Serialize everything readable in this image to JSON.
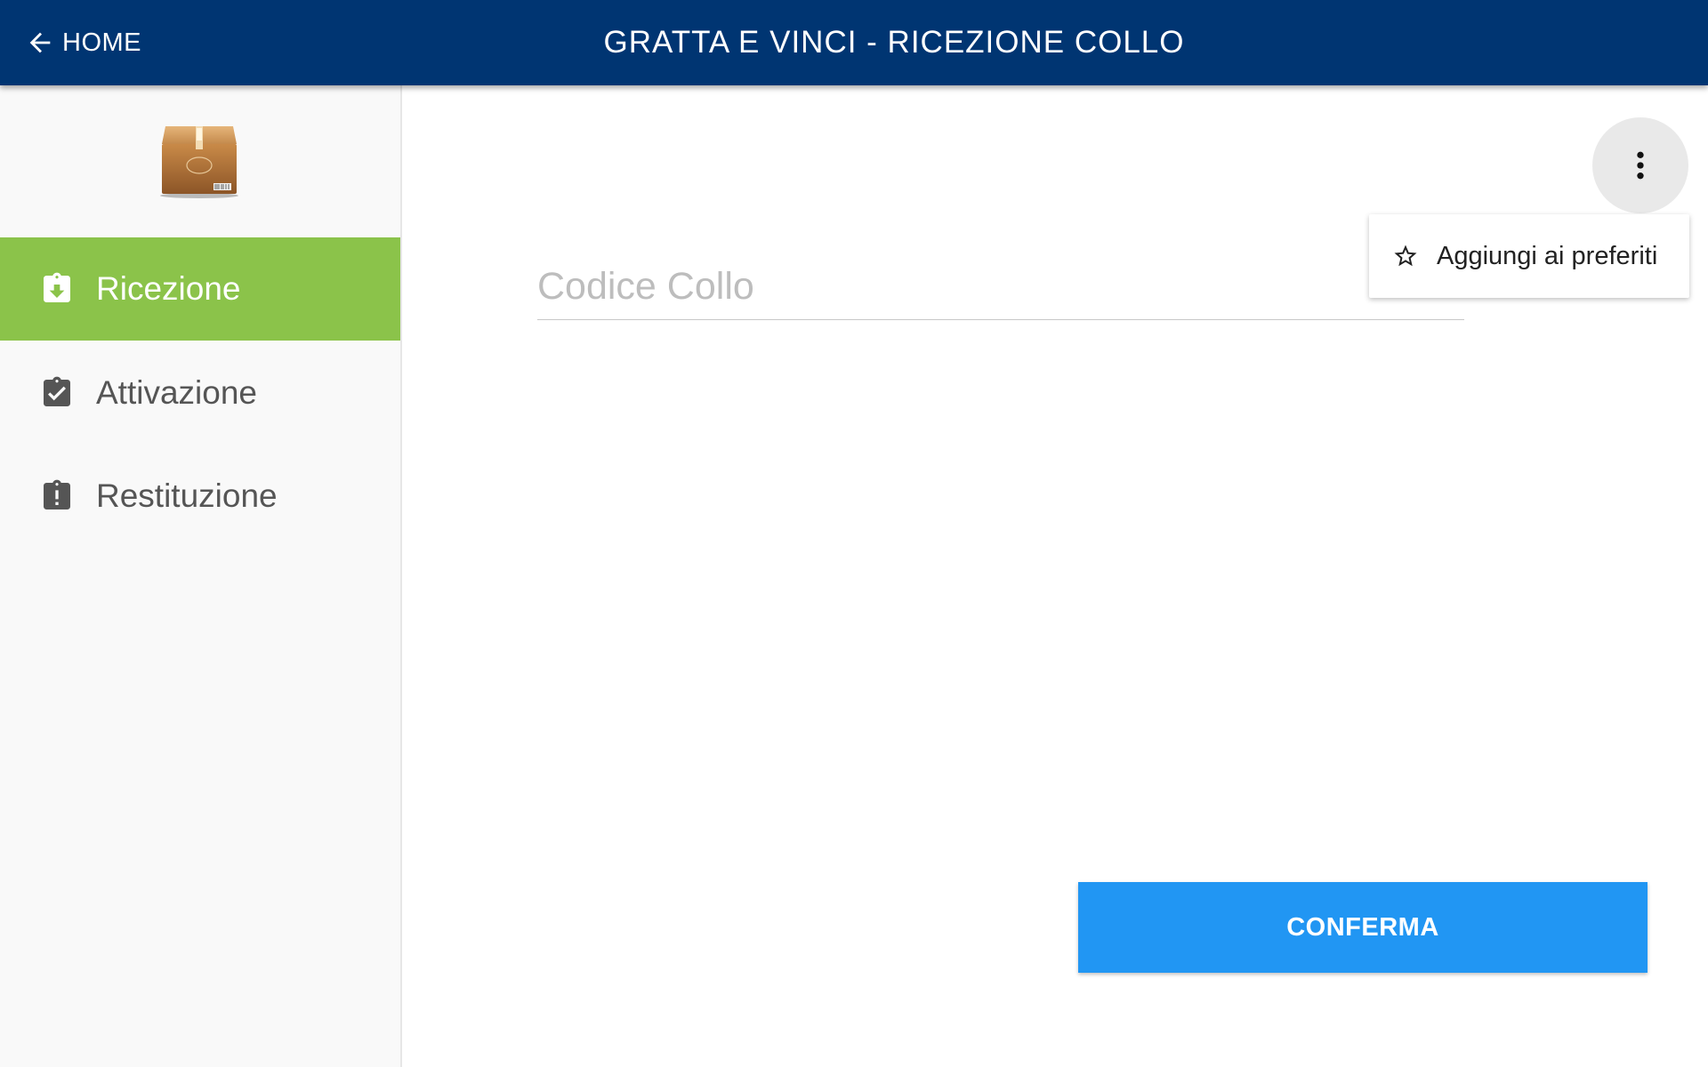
{
  "header": {
    "back_label": "HOME",
    "title": "GRATTA E VINCI - RICEZIONE COLLO",
    "background_color": "#003572"
  },
  "sidebar": {
    "logo_icon": "package-box-icon",
    "items": [
      {
        "label": "Ricezione",
        "icon": "clipboard-download-icon",
        "active": true
      },
      {
        "label": "Attivazione",
        "icon": "clipboard-check-icon",
        "active": false
      },
      {
        "label": "Restituzione",
        "icon": "clipboard-alert-icon",
        "active": false
      }
    ],
    "active_color": "#8bc34a"
  },
  "form": {
    "codice_collo_placeholder": "Codice Collo",
    "codice_collo_value": ""
  },
  "overflow_menu": {
    "icon": "more-vert-icon",
    "items": [
      {
        "label": "Aggiungi ai preferiti",
        "icon": "star-outline-icon"
      }
    ]
  },
  "actions": {
    "confirm_label": "CONFERMA",
    "confirm_color": "#2196f3"
  }
}
